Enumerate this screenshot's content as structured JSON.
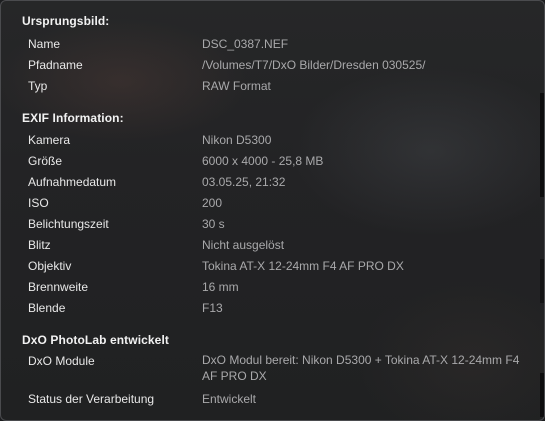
{
  "sections": [
    {
      "title": "Ursprungsbild:",
      "rows": [
        {
          "label": "Name",
          "value": "DSC_0387.NEF"
        },
        {
          "label": "Pfadname",
          "value": "/Volumes/T7/DxO Bilder/Dresden 030525/"
        },
        {
          "label": "Typ",
          "value": "RAW Format"
        }
      ]
    },
    {
      "title": "EXIF Information:",
      "rows": [
        {
          "label": "Kamera",
          "value": "Nikon D5300"
        },
        {
          "label": "Größe",
          "value": "6000 x 4000 - 25,8 MB"
        },
        {
          "label": "Aufnahmedatum",
          "value": "03.05.25, 21:32"
        },
        {
          "label": "ISO",
          "value": "200"
        },
        {
          "label": "Belichtungszeit",
          "value": "30 s"
        },
        {
          "label": "Blitz",
          "value": "Nicht ausgelöst"
        },
        {
          "label": "Objektiv",
          "value": "Tokina AT-X 12-24mm F4 AF PRO DX"
        },
        {
          "label": "Brennweite",
          "value": "16 mm"
        },
        {
          "label": "Blende",
          "value": "F13"
        }
      ]
    },
    {
      "title": "DxO PhotoLab entwickelt",
      "rows": [
        {
          "label": "DxO Module",
          "value": "DxO Modul bereit: Nikon D5300 + Tokina AT-X 12-24mm F4 AF PRO DX"
        },
        {
          "label": "Status der Verarbeitung",
          "value": "Entwickelt"
        }
      ]
    }
  ]
}
